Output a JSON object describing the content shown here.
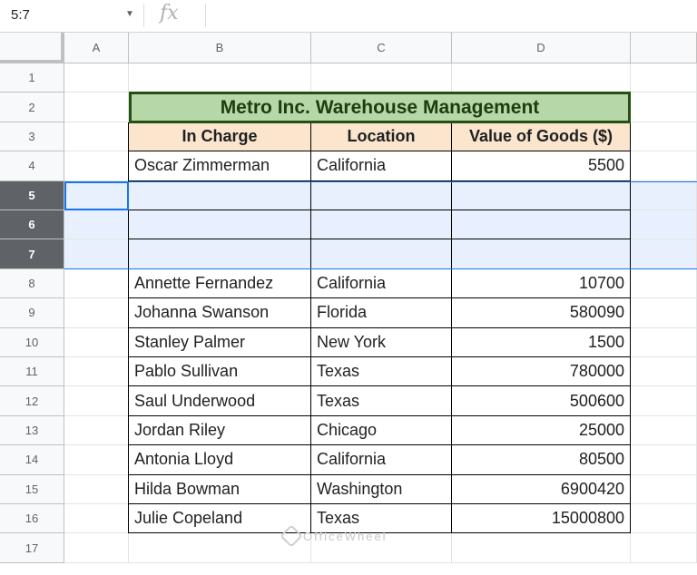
{
  "formula_bar": {
    "name_box": "5:7",
    "fx_label": "fx",
    "formula": ""
  },
  "columns": [
    "A",
    "B",
    "C",
    "D"
  ],
  "rows": [
    1,
    2,
    3,
    4,
    5,
    6,
    7,
    8,
    9,
    10,
    11,
    12,
    13,
    14,
    15,
    16,
    17
  ],
  "selected_rows": [
    5,
    6,
    7
  ],
  "title": "Metro Inc. Warehouse Management",
  "headers": [
    "In Charge",
    "Location",
    "Value of Goods ($)"
  ],
  "data": [
    {
      "row": 4,
      "name": "Oscar Zimmerman",
      "location": "California",
      "value": "5500"
    },
    {
      "row": 8,
      "name": "Annette Fernandez",
      "location": "California",
      "value": "10700"
    },
    {
      "row": 9,
      "name": "Johanna Swanson",
      "location": "Florida",
      "value": "580090"
    },
    {
      "row": 10,
      "name": "Stanley Palmer",
      "location": "New York",
      "value": "1500"
    },
    {
      "row": 11,
      "name": "Pablo Sullivan",
      "location": "Texas",
      "value": "780000"
    },
    {
      "row": 12,
      "name": "Saul Underwood",
      "location": "Texas",
      "value": "500600"
    },
    {
      "row": 13,
      "name": "Jordan Riley",
      "location": "Chicago",
      "value": "25000"
    },
    {
      "row": 14,
      "name": "Antonia Lloyd",
      "location": "California",
      "value": "80500"
    },
    {
      "row": 15,
      "name": "Hilda Bowman",
      "location": "Washington",
      "value": "6900420"
    },
    {
      "row": 16,
      "name": "Julie Copeland",
      "location": "Texas",
      "value": "15000800"
    }
  ],
  "watermark": "OfficeWheel"
}
